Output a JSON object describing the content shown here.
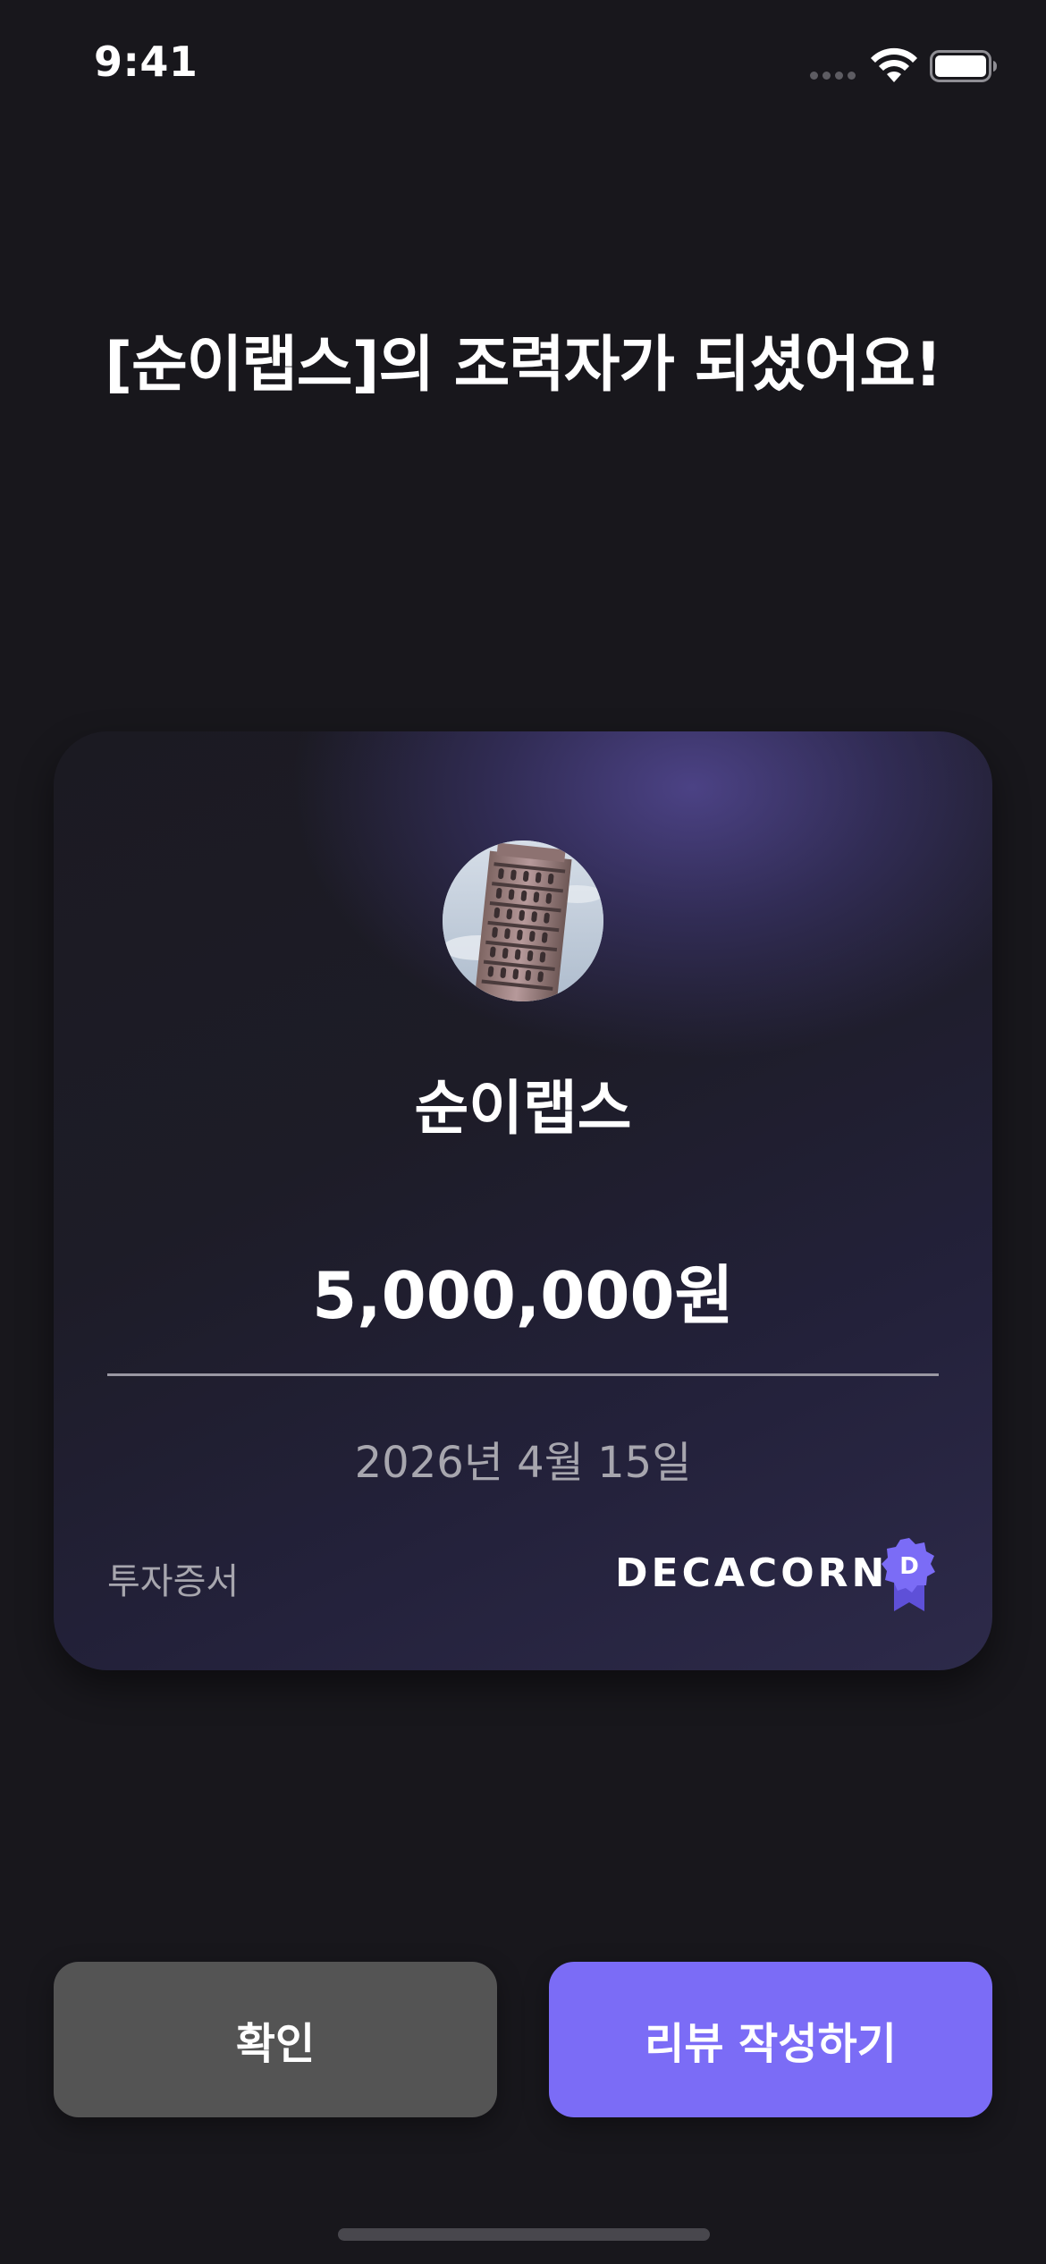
{
  "status_bar": {
    "time": "9:41"
  },
  "headline": "[순이랩스]의 조력자가 되셨어요!",
  "certificate": {
    "avatar_icon": "leaning-tower-photo",
    "company_name": "순이랩스",
    "amount": "5,000,000원",
    "date": "2026년 4월 15일",
    "label": "투자증서",
    "brand": "DECACORN",
    "badge_letter": "D",
    "badge_color": "#7b6cf6"
  },
  "buttons": {
    "confirm_label": "확인",
    "review_label": "리뷰 작성하기"
  },
  "colors": {
    "background": "#18171c",
    "accent": "#7b6cf6",
    "secondary_button": "#545454"
  }
}
